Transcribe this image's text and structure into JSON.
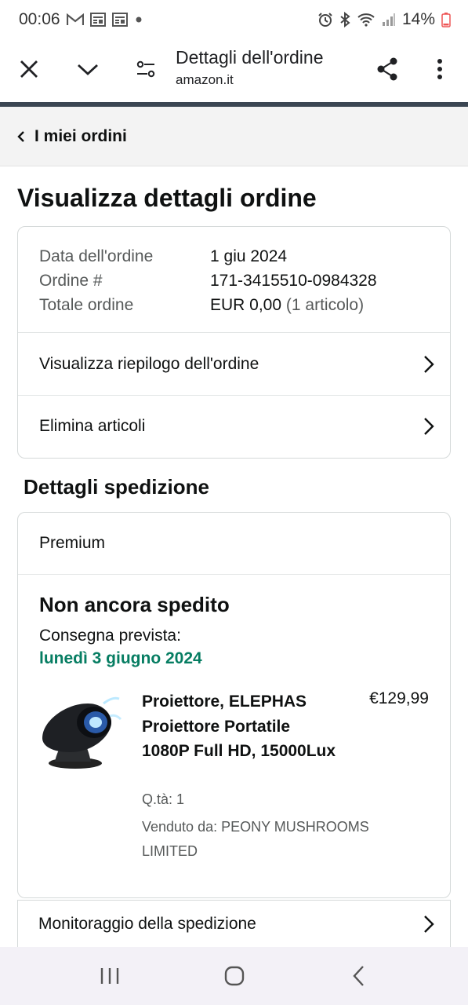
{
  "status_bar": {
    "time": "00:06",
    "battery": "14%",
    "left_icons": [
      "gmail-icon",
      "news-icon",
      "news-icon",
      "dot-icon"
    ],
    "right_icons": [
      "alarm-icon",
      "bluetooth-icon",
      "wifi-icon",
      "signal-icon",
      "battery-icon"
    ]
  },
  "browser": {
    "title": "Dettagli dell'ordine",
    "url": "amazon.it",
    "icons": [
      "close-icon",
      "chevron-down-icon",
      "site-settings-icon",
      "share-icon",
      "more-vert-icon"
    ]
  },
  "nav": {
    "back_label": "I miei ordini"
  },
  "page": {
    "title": "Visualizza dettagli ordine"
  },
  "order": {
    "date_label": "Data dell'ordine",
    "date_value": "1 giu 2024",
    "number_label": "Ordine #",
    "number_value": "171-3415510-0984328",
    "total_label": "Totale ordine",
    "total_value": "EUR 0,00",
    "total_count": "(1 articolo)",
    "summary_link": "Visualizza riepilogo dell'ordine",
    "delete_link": "Elimina articoli"
  },
  "shipping": {
    "section_title": "Dettagli spedizione",
    "method": "Premium",
    "status": "Non ancora spedito",
    "delivery_label": "Consegna prevista:",
    "delivery_date": "lunedì 3 giugno 2024",
    "item": {
      "title": "Proiettore, ELEPHAS Proiettore Portatile 1080P Full HD, 15000Lux",
      "price": "€129,99",
      "qty": "Q.tà: 1",
      "seller": "Venduto da: PEONY MUSHROOMS LIMITED"
    },
    "tracking_link": "Monitoraggio della spedizione"
  },
  "system_nav": {
    "icons": [
      "recents-icon",
      "home-icon",
      "back-icon"
    ]
  },
  "colors": {
    "delivery_green": "#067d62",
    "progress_bar": "#3b4652",
    "nav_background": "#f3f3f3"
  }
}
